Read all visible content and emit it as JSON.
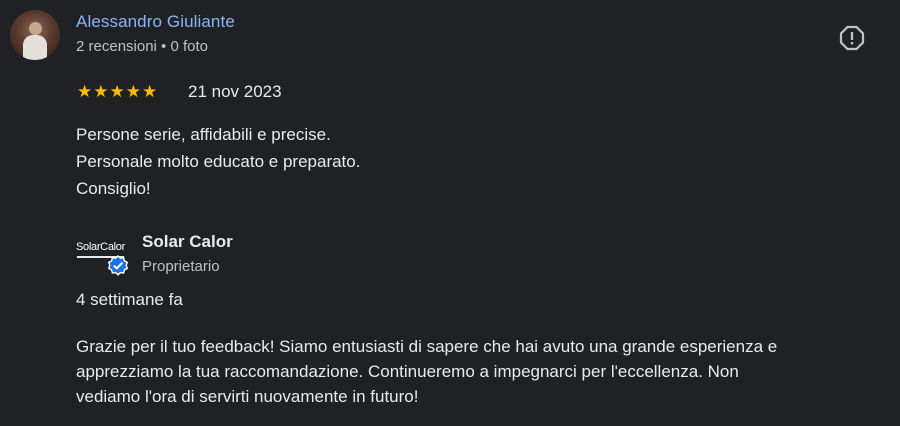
{
  "review": {
    "reviewer_name": "Alessandro Giuliante",
    "reviewer_meta": "2 recensioni • 0 foto",
    "stars": "★★★★★",
    "rating": 5,
    "date": "21 nov 2023",
    "text_lines": [
      "Persone serie, affidabili e precise.",
      "Personale molto educato e preparato.",
      "Consiglio!"
    ]
  },
  "owner_reply": {
    "logo_text": "SolarCalor",
    "owner_name": "Solar Calor",
    "owner_role": "Proprietario",
    "time": "4 settimane fa",
    "text_lines": [
      "Grazie per il tuo feedback! Siamo entusiasti di sapere che hai avuto una grande esperienza e",
      "apprezziamo la tua raccomandazione. Continueremo a impegnarci per l'eccellenza. Non",
      "vediamo l'ora di servirti nuovamente in futuro!"
    ]
  },
  "icons": {
    "report": "report-icon",
    "verified": "verified-badge-icon"
  },
  "colors": {
    "background": "#202124",
    "link": "#8ab4f8",
    "star": "#fbbc04",
    "verified": "#1a73e8"
  }
}
